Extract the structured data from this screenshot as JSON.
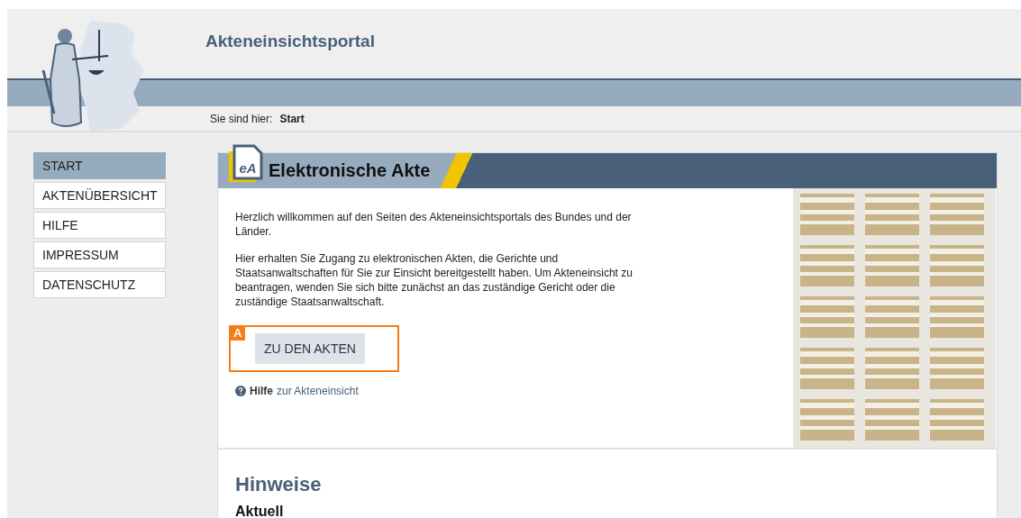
{
  "header": {
    "title": "Akteneinsichtsportal"
  },
  "breadcrumb": {
    "label": "Sie sind hier:",
    "current": "Start"
  },
  "nav": [
    {
      "label": "START",
      "selected": true
    },
    {
      "label": "AKTENÜBERSICHT",
      "selected": false
    },
    {
      "label": "HILFE",
      "selected": false
    },
    {
      "label": "IMPRESSUM",
      "selected": false
    },
    {
      "label": "DATENSCHUTZ",
      "selected": false
    }
  ],
  "panel": {
    "icon_text": "eA",
    "title": "Elektronische Akte",
    "paragraphs": [
      "Herzlich willkommen auf den Seiten des Akteneinsichtsportals des Bundes und der Länder.",
      "Hier erhalten Sie Zugang zu elektronischen Akten, die Gerichte und Staatsanwaltschaften für Sie zur Einsicht bereitgestellt haben. Um Akteneinsicht zu beantragen, wenden Sie sich bitte zunächst an das zuständige Gericht oder die zuständige Staatsanwaltschaft."
    ],
    "button": "ZU DEN AKTEN",
    "annotation": "A",
    "help_link": "Hilfe",
    "help_text": "zur Akteneinsicht"
  },
  "notes": {
    "title": "Hinweise",
    "subtitle": "Aktuell"
  }
}
